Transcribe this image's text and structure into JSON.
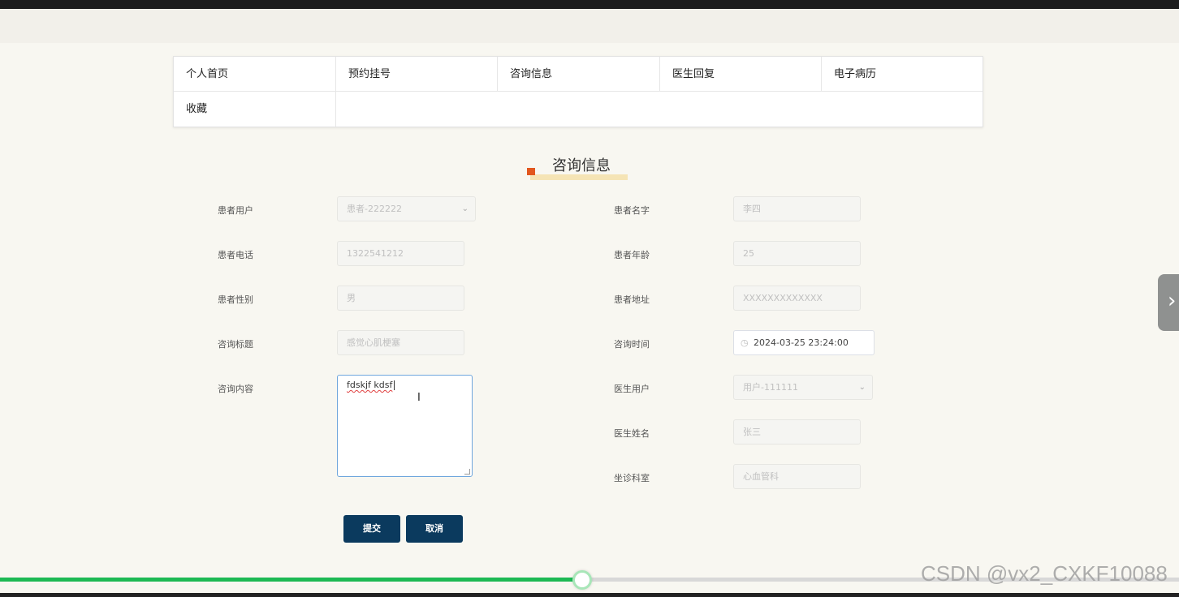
{
  "nav": {
    "items": [
      "个人首页",
      "预约挂号",
      "咨询信息",
      "医生回复",
      "电子病历",
      "收藏"
    ]
  },
  "page_title": "咨询信息",
  "form": {
    "left": [
      {
        "label": "患者用户",
        "value": "患者-222222",
        "type": "select"
      },
      {
        "label": "患者电话",
        "value": "1322541212",
        "type": "text"
      },
      {
        "label": "患者性别",
        "value": "男",
        "type": "text"
      },
      {
        "label": "咨询标题",
        "value": "感觉心肌梗塞",
        "type": "text"
      },
      {
        "label": "咨询内容",
        "value": "fdskjf kdsf",
        "type": "textarea"
      }
    ],
    "right": [
      {
        "label": "患者名字",
        "value": "李四",
        "type": "text"
      },
      {
        "label": "患者年龄",
        "value": "25",
        "type": "text"
      },
      {
        "label": "患者地址",
        "value": "XXXXXXXXXXXXX",
        "type": "text"
      },
      {
        "label": "咨询时间",
        "value": "2024-03-25 23:24:00",
        "type": "datetime"
      },
      {
        "label": "医生用户",
        "value": "用户-111111",
        "type": "select"
      },
      {
        "label": "医生姓名",
        "value": "张三",
        "type": "text"
      },
      {
        "label": "坐诊科室",
        "value": "心血管科",
        "type": "text"
      }
    ],
    "submit_label": "提交",
    "cancel_label": "取消"
  },
  "side_arrow_glyph": "›",
  "video": {
    "progress": 0.494
  },
  "watermark": "CSDN @vx2_CXKF10088",
  "colors": {
    "button": "#0b3a5e",
    "accent_mark": "#e2571e",
    "progress": "#1db954"
  }
}
